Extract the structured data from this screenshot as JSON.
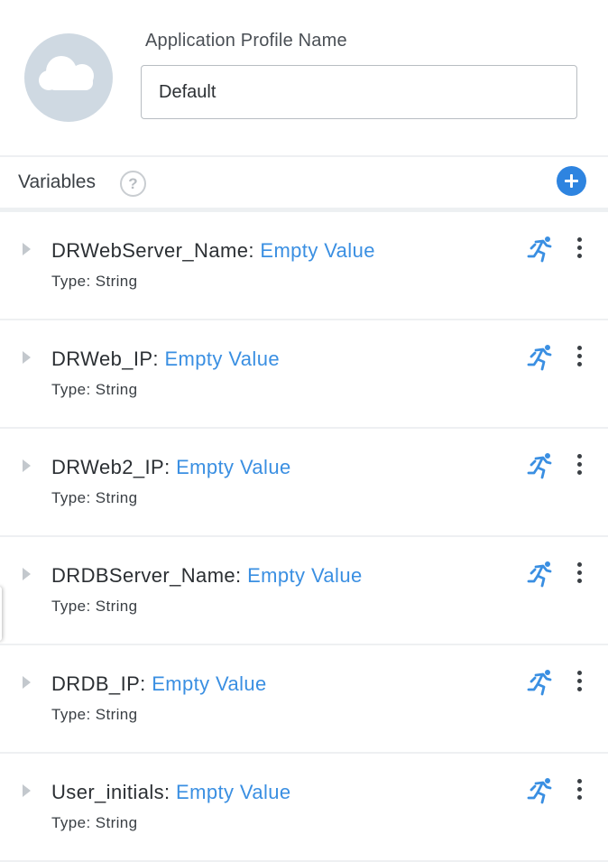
{
  "profile": {
    "label": "Application Profile Name",
    "name_value": "Default",
    "avatar_icon": "cloud-icon"
  },
  "variables_section": {
    "title": "Variables",
    "help_glyph": "?",
    "help_icon": "help-icon",
    "add_icon": "plus-icon"
  },
  "colors": {
    "accent": "#2e84e0",
    "value_text": "#3a8fe2",
    "avatar_bg": "#cfd9e2"
  },
  "variables": [
    {
      "name": "DRWebServer_Name:",
      "value": "Empty Value",
      "type_text": "Type: String"
    },
    {
      "name": "DRWeb_IP:",
      "value": "Empty Value",
      "type_text": "Type: String"
    },
    {
      "name": "DRWeb2_IP:",
      "value": "Empty Value",
      "type_text": "Type: String"
    },
    {
      "name": "DRDBServer_Name:",
      "value": "Empty Value",
      "type_text": "Type: String"
    },
    {
      "name": "DRDB_IP:",
      "value": "Empty Value",
      "type_text": "Type: String"
    },
    {
      "name": "User_initials:",
      "value": "Empty Value",
      "type_text": "Type: String"
    }
  ],
  "row_icons": [
    "expand-caret-icon",
    "runtime-running-icon",
    "more-options-icon"
  ]
}
